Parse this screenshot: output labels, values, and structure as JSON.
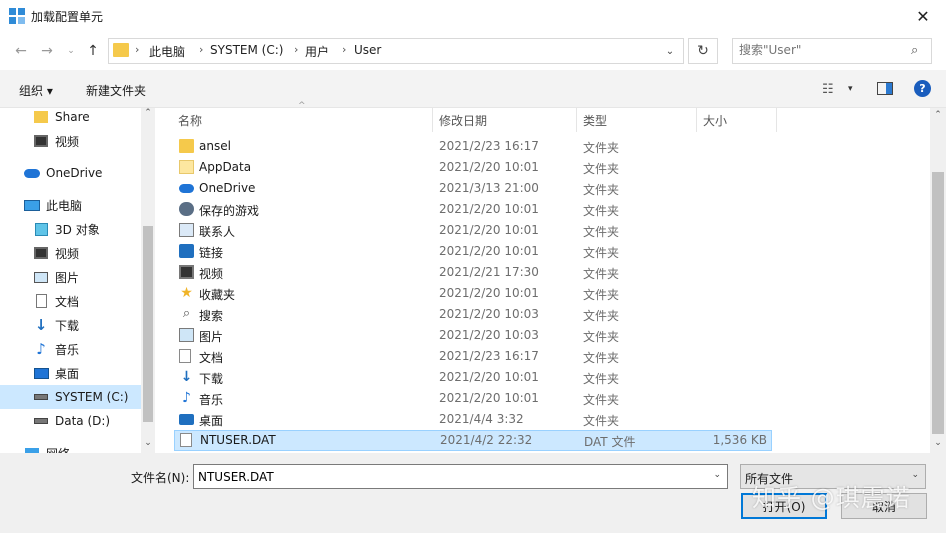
{
  "window": {
    "title": "加载配置单元",
    "close": "✕"
  },
  "address": {
    "crumbs": [
      "此电脑",
      "SYSTEM (C:)",
      "用户",
      "User"
    ],
    "separator": "›",
    "refresh": "↻",
    "dropdown": "⌄"
  },
  "search": {
    "placeholder": "搜索\"User\"",
    "icon": "⌕"
  },
  "toolbar": {
    "organize": "组织 ▾",
    "new_folder": "新建文件夹",
    "view": "☷",
    "view_drop": "▾",
    "help": "?"
  },
  "nav": {
    "items": [
      {
        "label": "Share",
        "icon": "folder"
      },
      {
        "label": "视频",
        "icon": "video"
      },
      {
        "label": "OneDrive",
        "icon": "cloud"
      },
      {
        "label": "此电脑",
        "icon": "pc"
      },
      {
        "label": "3D 对象",
        "icon": "cube"
      },
      {
        "label": "视频",
        "icon": "video"
      },
      {
        "label": "图片",
        "icon": "pictures"
      },
      {
        "label": "文档",
        "icon": "document"
      },
      {
        "label": "下载",
        "icon": "download"
      },
      {
        "label": "音乐",
        "icon": "music"
      },
      {
        "label": "桌面",
        "icon": "desktop"
      },
      {
        "label": "SYSTEM (C:)",
        "icon": "drive"
      },
      {
        "label": "Data (D:)",
        "icon": "drive"
      },
      {
        "label": "网络",
        "icon": "network"
      }
    ]
  },
  "columns": {
    "name": "名称",
    "date": "修改日期",
    "type": "类型",
    "size": "大小"
  },
  "files": [
    {
      "name": "ansel",
      "date": "2021/2/23 16:17",
      "type": "文件夹",
      "size": "",
      "icon": "folder"
    },
    {
      "name": "AppData",
      "date": "2021/2/20 10:01",
      "type": "文件夹",
      "size": "",
      "icon": "folder-hidden"
    },
    {
      "name": "OneDrive",
      "date": "2021/3/13 21:00",
      "type": "文件夹",
      "size": "",
      "icon": "cloud"
    },
    {
      "name": "保存的游戏",
      "date": "2021/2/20 10:01",
      "type": "文件夹",
      "size": "",
      "icon": "games"
    },
    {
      "name": "联系人",
      "date": "2021/2/20 10:01",
      "type": "文件夹",
      "size": "",
      "icon": "contacts"
    },
    {
      "name": "链接",
      "date": "2021/2/20 10:01",
      "type": "文件夹",
      "size": "",
      "icon": "links"
    },
    {
      "name": "视频",
      "date": "2021/2/21 17:30",
      "type": "文件夹",
      "size": "",
      "icon": "video"
    },
    {
      "name": "收藏夹",
      "date": "2021/2/20 10:01",
      "type": "文件夹",
      "size": "",
      "icon": "favorites"
    },
    {
      "name": "搜索",
      "date": "2021/2/20 10:03",
      "type": "文件夹",
      "size": "",
      "icon": "search"
    },
    {
      "name": "图片",
      "date": "2021/2/20 10:03",
      "type": "文件夹",
      "size": "",
      "icon": "pictures"
    },
    {
      "name": "文档",
      "date": "2021/2/23 16:17",
      "type": "文件夹",
      "size": "",
      "icon": "document"
    },
    {
      "name": "下载",
      "date": "2021/2/20 10:01",
      "type": "文件夹",
      "size": "",
      "icon": "download"
    },
    {
      "name": "音乐",
      "date": "2021/2/20 10:01",
      "type": "文件夹",
      "size": "",
      "icon": "music"
    },
    {
      "name": "桌面",
      "date": "2021/4/4 3:32",
      "type": "文件夹",
      "size": "",
      "icon": "desktop"
    },
    {
      "name": "NTUSER.DAT",
      "date": "2021/4/2 22:32",
      "type": "DAT 文件",
      "size": "1,536 KB",
      "icon": "file"
    }
  ],
  "bottom": {
    "filename_label": "文件名(N):",
    "filename_value": "NTUSER.DAT",
    "filetype": "所有文件",
    "open": "打开(O)",
    "cancel": "取消"
  },
  "watermark": "知乎 @琪震诺",
  "colors": {
    "accent": "#0078d7",
    "selection": "#cce8ff",
    "selection_border": "#99d1ff"
  }
}
